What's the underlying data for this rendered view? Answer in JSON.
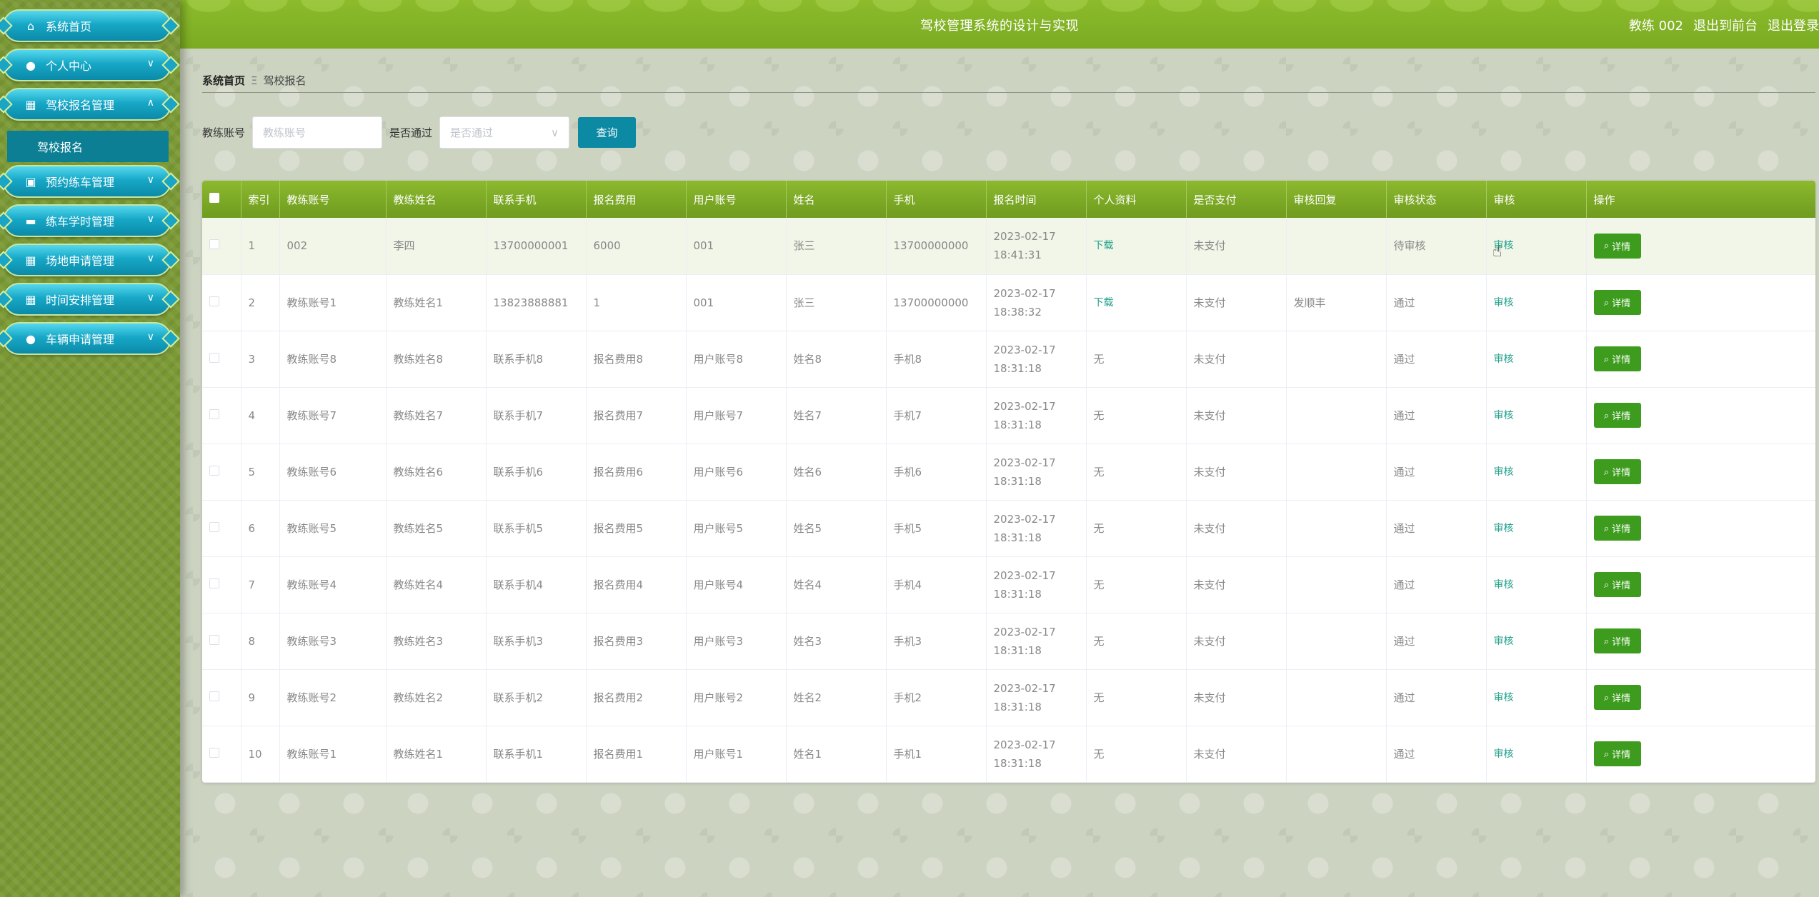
{
  "header": {
    "title": "驾校管理系统的设计与实现",
    "user": "教练 002",
    "to_front": "退出到前台",
    "logout": "退出登录"
  },
  "sidebar": {
    "items": [
      {
        "label": "系统首页",
        "icon": "home-icon"
      },
      {
        "label": "个人中心",
        "icon": "user-icon"
      },
      {
        "label": "驾校报名管理",
        "icon": "grid-icon",
        "expanded": true
      },
      {
        "label": "预约练车管理",
        "icon": "calendar-icon"
      },
      {
        "label": "练车学时管理",
        "icon": "car-icon"
      },
      {
        "label": "场地申请管理",
        "icon": "grid-icon"
      },
      {
        "label": "时间安排管理",
        "icon": "grid-icon"
      },
      {
        "label": "车辆申请管理",
        "icon": "user-icon"
      }
    ],
    "submenu": {
      "label": "驾校报名"
    }
  },
  "breadcrumb": {
    "home": "系统首页",
    "sep": "Ξ",
    "current": "驾校报名"
  },
  "search": {
    "coach_label": "教练账号",
    "coach_placeholder": "教练账号",
    "pass_label": "是否通过",
    "pass_placeholder": "是否通过",
    "button": "查询"
  },
  "table": {
    "columns": [
      "",
      "索引",
      "教练账号",
      "教练姓名",
      "联系手机",
      "报名费用",
      "用户账号",
      "姓名",
      "手机",
      "报名时间",
      "个人资料",
      "是否支付",
      "审核回复",
      "审核状态",
      "审核",
      "操作"
    ],
    "rows": [
      {
        "idx": "1",
        "coach": "002",
        "cname": "李四",
        "phone": "13700000001",
        "fee": "6000",
        "uacc": "001",
        "name": "张三",
        "mobile": "13700000000",
        "time": "2023-02-17 18:41:31",
        "profile": "下载",
        "paid": "未支付",
        "reply": "",
        "status": "待审核",
        "audit": "审核",
        "op": "详情"
      },
      {
        "idx": "2",
        "coach": "教练账号1",
        "cname": "教练姓名1",
        "phone": "13823888881",
        "fee": "1",
        "uacc": "001",
        "name": "张三",
        "mobile": "13700000000",
        "time": "2023-02-17 18:38:32",
        "profile": "下载",
        "paid": "未支付",
        "reply": "发顺丰",
        "status": "通过",
        "audit": "审核",
        "op": "详情"
      },
      {
        "idx": "3",
        "coach": "教练账号8",
        "cname": "教练姓名8",
        "phone": "联系手机8",
        "fee": "报名费用8",
        "uacc": "用户账号8",
        "name": "姓名8",
        "mobile": "手机8",
        "time": "2023-02-17 18:31:18",
        "profile": "无",
        "paid": "未支付",
        "reply": "",
        "status": "通过",
        "audit": "审核",
        "op": "详情"
      },
      {
        "idx": "4",
        "coach": "教练账号7",
        "cname": "教练姓名7",
        "phone": "联系手机7",
        "fee": "报名费用7",
        "uacc": "用户账号7",
        "name": "姓名7",
        "mobile": "手机7",
        "time": "2023-02-17 18:31:18",
        "profile": "无",
        "paid": "未支付",
        "reply": "",
        "status": "通过",
        "audit": "审核",
        "op": "详情"
      },
      {
        "idx": "5",
        "coach": "教练账号6",
        "cname": "教练姓名6",
        "phone": "联系手机6",
        "fee": "报名费用6",
        "uacc": "用户账号6",
        "name": "姓名6",
        "mobile": "手机6",
        "time": "2023-02-17 18:31:18",
        "profile": "无",
        "paid": "未支付",
        "reply": "",
        "status": "通过",
        "audit": "审核",
        "op": "详情"
      },
      {
        "idx": "6",
        "coach": "教练账号5",
        "cname": "教练姓名5",
        "phone": "联系手机5",
        "fee": "报名费用5",
        "uacc": "用户账号5",
        "name": "姓名5",
        "mobile": "手机5",
        "time": "2023-02-17 18:31:18",
        "profile": "无",
        "paid": "未支付",
        "reply": "",
        "status": "通过",
        "audit": "审核",
        "op": "详情"
      },
      {
        "idx": "7",
        "coach": "教练账号4",
        "cname": "教练姓名4",
        "phone": "联系手机4",
        "fee": "报名费用4",
        "uacc": "用户账号4",
        "name": "姓名4",
        "mobile": "手机4",
        "time": "2023-02-17 18:31:18",
        "profile": "无",
        "paid": "未支付",
        "reply": "",
        "status": "通过",
        "audit": "审核",
        "op": "详情"
      },
      {
        "idx": "8",
        "coach": "教练账号3",
        "cname": "教练姓名3",
        "phone": "联系手机3",
        "fee": "报名费用3",
        "uacc": "用户账号3",
        "name": "姓名3",
        "mobile": "手机3",
        "time": "2023-02-17 18:31:18",
        "profile": "无",
        "paid": "未支付",
        "reply": "",
        "status": "通过",
        "audit": "审核",
        "op": "详情"
      },
      {
        "idx": "9",
        "coach": "教练账号2",
        "cname": "教练姓名2",
        "phone": "联系手机2",
        "fee": "报名费用2",
        "uacc": "用户账号2",
        "name": "姓名2",
        "mobile": "手机2",
        "time": "2023-02-17 18:31:18",
        "profile": "无",
        "paid": "未支付",
        "reply": "",
        "status": "通过",
        "audit": "审核",
        "op": "详情"
      },
      {
        "idx": "10",
        "coach": "教练账号1",
        "cname": "教练姓名1",
        "phone": "联系手机1",
        "fee": "报名费用1",
        "uacc": "用户账号1",
        "name": "姓名1",
        "mobile": "手机1",
        "time": "2023-02-17 18:31:18",
        "profile": "无",
        "paid": "未支付",
        "reply": "",
        "status": "通过",
        "audit": "审核",
        "op": "详情"
      }
    ]
  },
  "colors": {
    "header_green": "#7aab22",
    "menu_cyan": "#17a8c7",
    "accent_teal": "#0d8aa3",
    "detail_green": "#3d9c1e"
  }
}
